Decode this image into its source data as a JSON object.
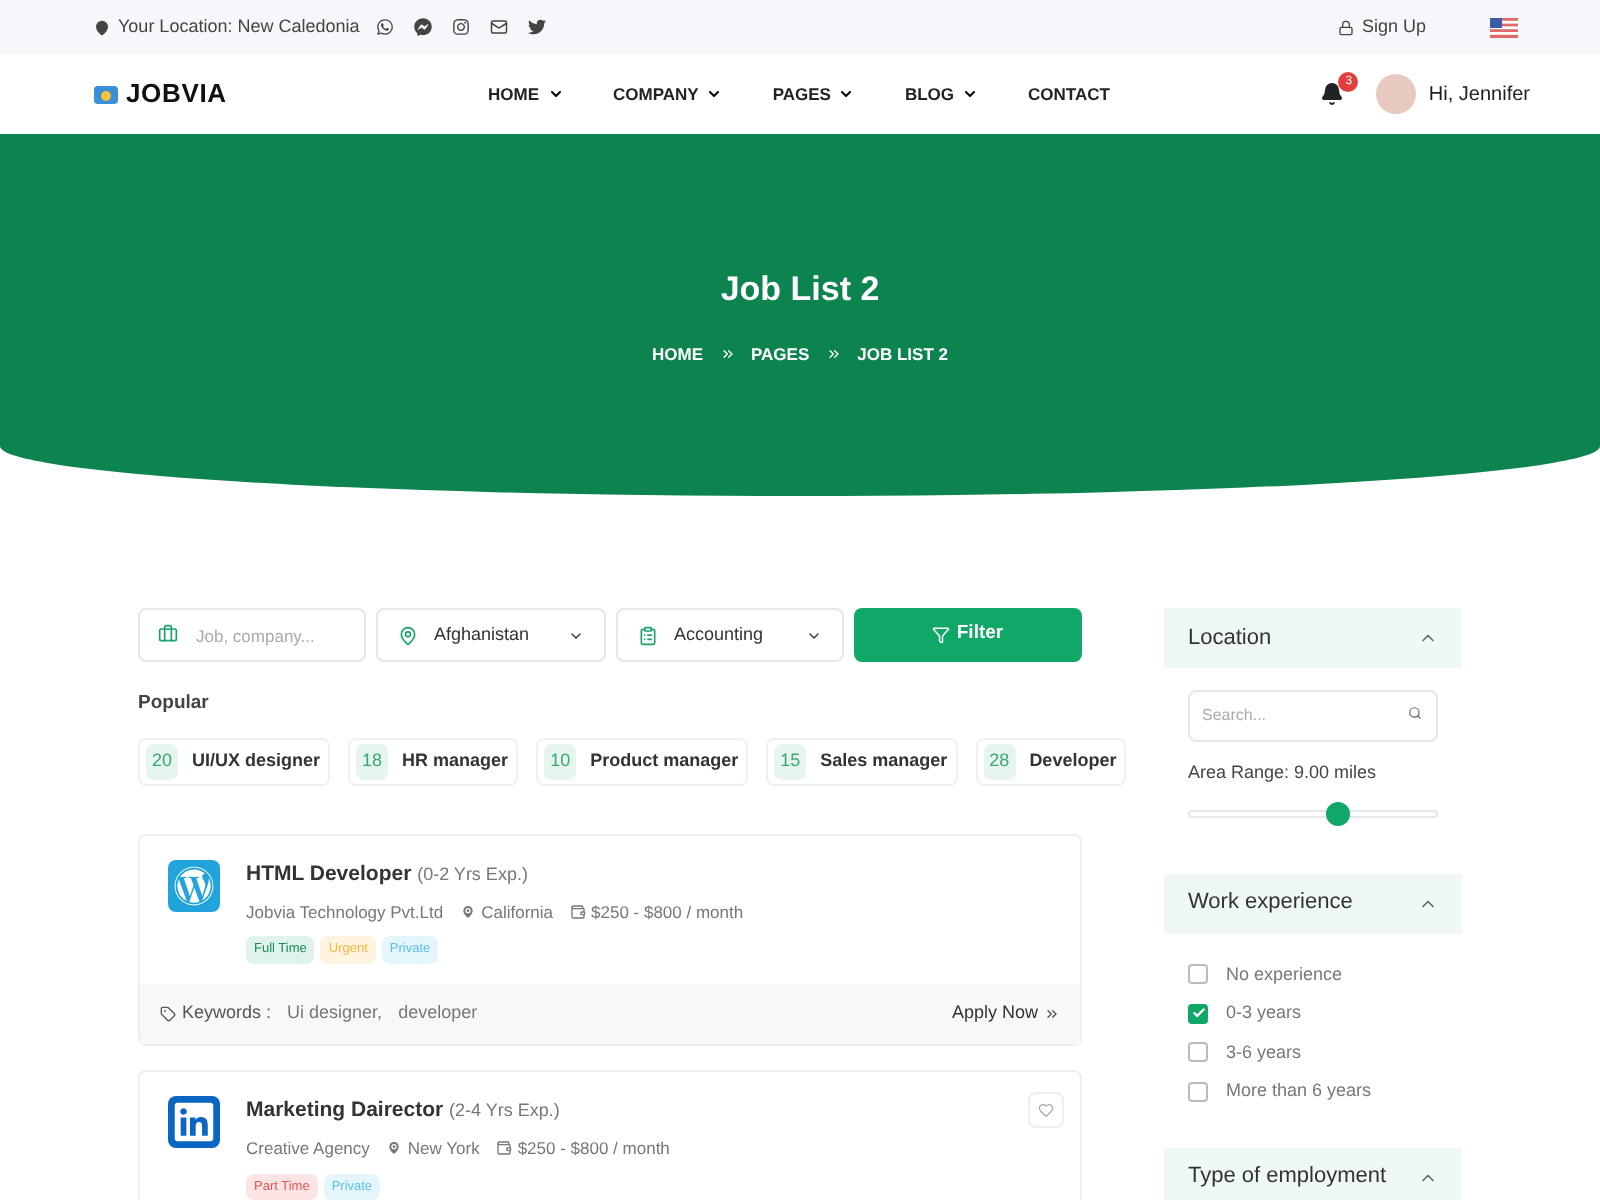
{
  "topbar": {
    "location": "Your Location: New Caledonia",
    "sign_up": "Sign Up"
  },
  "nav": {
    "logo": "JOBVIA",
    "items": [
      {
        "label": "HOME",
        "dropdown": true
      },
      {
        "label": "COMPANY",
        "dropdown": true
      },
      {
        "label": "PAGES",
        "dropdown": true
      },
      {
        "label": "BLOG",
        "dropdown": true
      },
      {
        "label": "CONTACT",
        "dropdown": false
      }
    ],
    "notifications": "3",
    "user": "Hi, Jennifer"
  },
  "hero": {
    "title": "Job List 2",
    "breadcrumb": [
      "HOME",
      "PAGES",
      "JOB LIST 2"
    ]
  },
  "search": {
    "placeholder": "Job, company...",
    "location": "Afghanistan",
    "category": "Accounting",
    "button": "Filter"
  },
  "popular": {
    "title": "Popular",
    "items": [
      {
        "count": "20",
        "label": "UI/UX designer"
      },
      {
        "count": "18",
        "label": "HR manager"
      },
      {
        "count": "10",
        "label": "Product manager"
      },
      {
        "count": "15",
        "label": "Sales manager"
      },
      {
        "count": "28",
        "label": "Developer"
      }
    ]
  },
  "jobs": [
    {
      "kind": "wordpress",
      "title": "HTML Developer",
      "experience": "(0-2 Yrs Exp.)",
      "company": "Jobvia Technology Pvt.Ltd",
      "location": "California",
      "salary": "$250 - $800 / month",
      "tags": [
        {
          "label": "Full Time",
          "kind": "fulltime"
        },
        {
          "label": "Urgent",
          "kind": "urgent"
        },
        {
          "label": "Private",
          "kind": "private"
        }
      ],
      "favorite_button": false,
      "keywords_label": "Keywords :",
      "keywords": [
        "Ui designer,",
        "developer"
      ],
      "apply": "Apply Now"
    },
    {
      "kind": "linkedin",
      "title": "Marketing Dairector",
      "experience": "(2-4 Yrs Exp.)",
      "company": "Creative Agency",
      "location": "New York",
      "salary": "$250 - $800 / month",
      "tags": [
        {
          "label": "Part Time",
          "kind": "parttime"
        },
        {
          "label": "Private",
          "kind": "private"
        }
      ],
      "favorite_button": true
    }
  ],
  "sidebar": {
    "location": {
      "title": "Location",
      "expanded": true,
      "search_placeholder": "Search...",
      "range_label": "Area Range: 9.00 miles",
      "level": 0.6
    },
    "experience": {
      "title": "Work experience",
      "expanded": true,
      "options": [
        {
          "label": "No experience",
          "checked": false
        },
        {
          "label": "0-3 years",
          "checked": true
        },
        {
          "label": "3-6 years",
          "checked": false
        },
        {
          "label": "More than 6 years",
          "checked": false
        }
      ]
    },
    "employment": {
      "title": "Type of employment",
      "expanded": true
    }
  }
}
